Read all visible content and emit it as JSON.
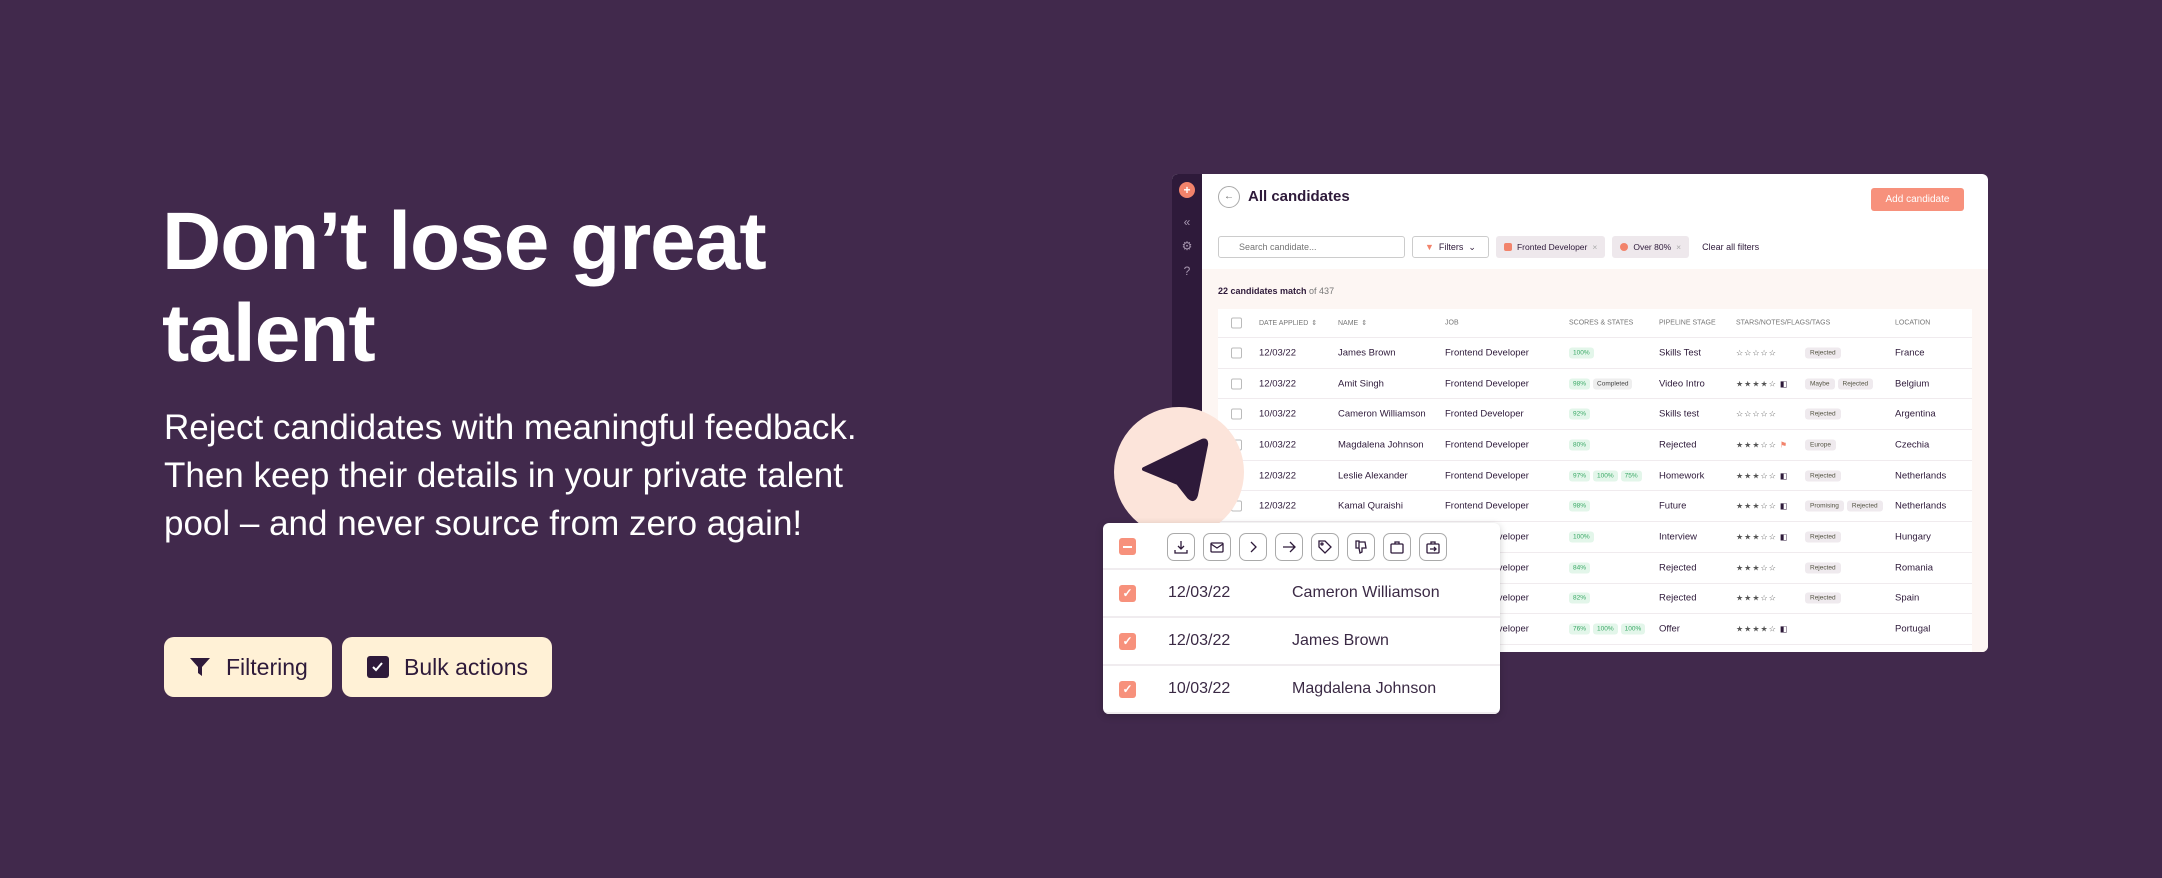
{
  "hero": {
    "title": "Don’t lose great talent",
    "body": "Reject candidates with meaningful feedback. Then keep their details in your private talent pool – and never source from zero again!",
    "buttons": [
      {
        "label": "Filtering",
        "icon": "filter-icon"
      },
      {
        "label": "Bulk actions",
        "icon": "checkbox-checked-icon"
      }
    ]
  },
  "colors": {
    "background": "#41294c",
    "accent": "#f7917c",
    "pill": "#fff1d6",
    "sidebar": "#2e1a3a"
  },
  "app": {
    "title": "All candidates",
    "add_label": "Add candidate",
    "search_placeholder": "Search candidate...",
    "filters_label": "Filters",
    "chips": [
      "Fronted Developer",
      "Over 80%"
    ],
    "clear_label": "Clear all filters",
    "count_bold": "22 candidates match",
    "count_rest": " of 437",
    "columns": [
      "Date applied",
      "Name",
      "Job",
      "Scores & states",
      "Pipeline stage",
      "Stars/notes/flags/tags",
      "Location"
    ],
    "rows": [
      {
        "date": "12/03/22",
        "name": "James Brown",
        "job": "Frontend Developer",
        "scores": [
          "100%"
        ],
        "stage": "Skills Test",
        "stars": 0,
        "note": false,
        "flag": false,
        "tags": [
          "Rejected"
        ],
        "location": "France"
      },
      {
        "date": "12/03/22",
        "name": "Amit Singh",
        "job": "Frontend Developer",
        "scores": [
          "98%"
        ],
        "states": [
          "Completed"
        ],
        "stage": "Video Intro",
        "stars": 4,
        "note": true,
        "flag": false,
        "tags": [
          "Maybe",
          "Rejected"
        ],
        "location": "Belgium"
      },
      {
        "date": "10/03/22",
        "name": "Cameron Williamson",
        "job": "Fronted Developer",
        "scores": [
          "92%"
        ],
        "stage": "Skills test",
        "stars": 0,
        "note": false,
        "flag": false,
        "tags": [
          "Rejected"
        ],
        "location": "Argentina"
      },
      {
        "date": "10/03/22",
        "name": "Magdalena Johnson",
        "job": "Frontend Developer",
        "scores": [
          "80%"
        ],
        "stage": "Rejected",
        "stars": 3,
        "note": false,
        "flag": true,
        "tags": [
          "Europe"
        ],
        "location": "Czechia"
      },
      {
        "date": "12/03/22",
        "name": "Leslie Alexander",
        "job": "Frontend Developer",
        "scores": [
          "97%",
          "100%",
          "75%"
        ],
        "stage": "Homework",
        "stars": 3,
        "note": true,
        "flag": false,
        "tags": [
          "Rejected"
        ],
        "location": "Netherlands"
      },
      {
        "date": "12/03/22",
        "name": "Kamal Quraishi",
        "job": "Frontend Developer",
        "scores": [
          "98%"
        ],
        "stage": "Future",
        "stars": 3,
        "note": true,
        "flag": false,
        "tags": [
          "Promising",
          "Rejected"
        ],
        "location": "Netherlands"
      },
      {
        "job": "Frontend Developer",
        "scores": [
          "100%"
        ],
        "stage": "Interview",
        "stars": 3,
        "note": true,
        "flag": false,
        "tags": [
          "Rejected"
        ],
        "location": "Hungary"
      },
      {
        "job": "Frontend Developer",
        "scores": [
          "84%"
        ],
        "stage": "Rejected",
        "stars": 3,
        "note": false,
        "flag": false,
        "tags": [
          "Rejected"
        ],
        "location": "Romania"
      },
      {
        "job": "Frontend Developer",
        "scores": [
          "82%"
        ],
        "stage": "Rejected",
        "stars": 3,
        "note": false,
        "flag": false,
        "tags": [
          "Rejected"
        ],
        "location": "Spain"
      },
      {
        "job": "Frontend Developer",
        "scores": [
          "76%",
          "100%",
          "100%"
        ],
        "stage": "Offer",
        "stars": 4,
        "note": true,
        "flag": false,
        "tags": [],
        "location": "Portugal"
      }
    ]
  },
  "bulk": {
    "actions": [
      "download-icon",
      "email-icon",
      "chevron-right-icon",
      "arrow-right-icon",
      "tag-icon",
      "thumbs-down-icon",
      "briefcase-icon",
      "move-to-job-icon"
    ],
    "rows": [
      {
        "date": "12/03/22",
        "name": "Cameron Williamson"
      },
      {
        "date": "12/03/22",
        "name": "James Brown"
      },
      {
        "date": "10/03/22",
        "name": "Magdalena Johnson"
      }
    ]
  }
}
